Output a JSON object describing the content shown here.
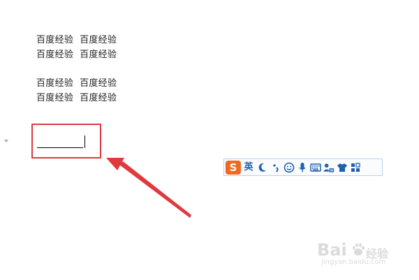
{
  "document": {
    "lines": [
      "百度经验  百度经验",
      "百度经验  百度经验",
      "百度经验  百度经验",
      "百度经验  百度经验"
    ]
  },
  "ime_toolbar": {
    "logo": "S",
    "language": "英",
    "buttons": [
      "half-moon-icon",
      "punctuation-icon",
      "emoji-icon",
      "microphone-icon",
      "keyboard-icon",
      "user-icon",
      "skin-icon",
      "toolbox-icon"
    ],
    "accent_color": "#1f5fae",
    "logo_color": "#f26722"
  },
  "annotation": {
    "box_color": "#e0393e",
    "arrow_color": "#e0393e"
  },
  "watermark": {
    "logo_text": "Bai",
    "suffix_text": "经验",
    "url": "jingyan.baidu.com"
  }
}
